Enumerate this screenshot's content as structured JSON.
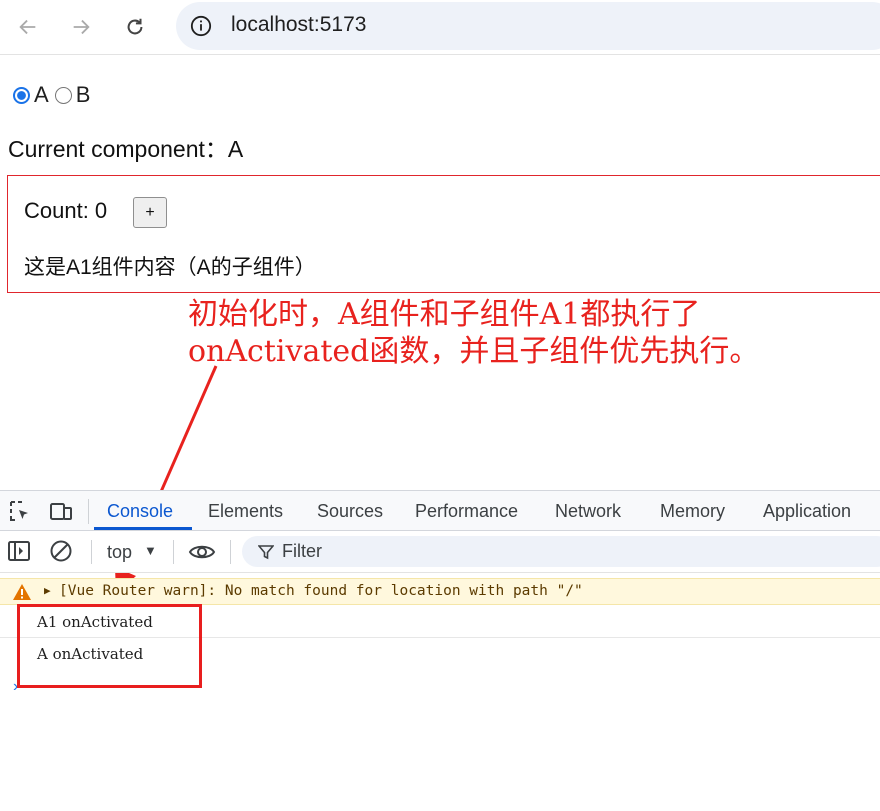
{
  "browser": {
    "url": "localhost:5173",
    "icons": [
      "back-icon",
      "forward-icon",
      "reload-icon",
      "site-info-icon"
    ]
  },
  "page": {
    "radio_a": "A",
    "radio_b": "B",
    "selected": "A",
    "current_label": "Current component：A",
    "count_label": "Count: 0",
    "plus_label": "+",
    "a1_text": "这是A1组件内容（A的子组件）"
  },
  "annotation": {
    "line1": "初始化时，A组件和子组件A1都执行了",
    "line2": "onActivated函数，并且子组件优先执行。",
    "color": "#e8221e"
  },
  "devtools": {
    "tabs": [
      "Console",
      "Elements",
      "Sources",
      "Performance",
      "Network",
      "Memory",
      "Application"
    ],
    "active_tab": "Console",
    "context": "top",
    "filter_placeholder": "Filter",
    "warning": "[Vue Router warn]: No match found for location with path \"/\"",
    "logs": [
      "A1 onActivated",
      "A onActivated"
    ],
    "accent": "#0b57d0"
  }
}
